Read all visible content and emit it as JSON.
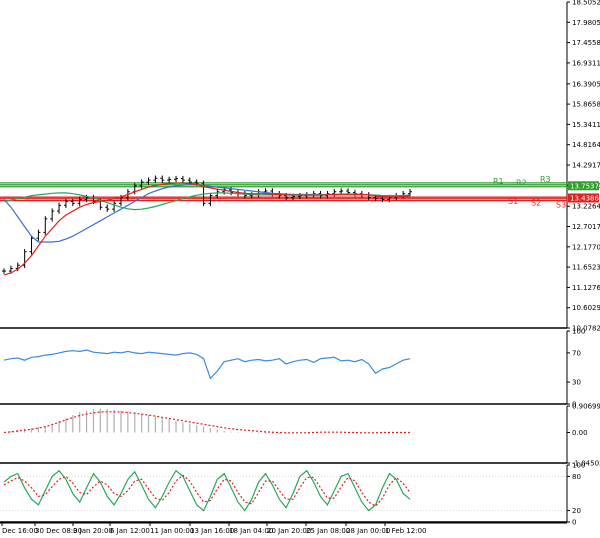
{
  "chart_data": [
    {
      "type": "line",
      "name": "price",
      "y_ticks": [
        "18.50520",
        "17.98050",
        "17.45580",
        "16.93110",
        "16.39050",
        "15.86580",
        "15.34110",
        "14.81640",
        "14.29170",
        "13.76700",
        "13.22640",
        "12.70170",
        "12.17700",
        "11.65230",
        "11.12760",
        "10.60290",
        "10.07820"
      ],
      "price_tags": [
        {
          "label": "13.75374",
          "value": 13.754,
          "color": "#2e9e2e"
        },
        {
          "label": "13.43861",
          "value": 13.439,
          "color": "#e02020"
        }
      ],
      "levels": [
        {
          "name": "R1",
          "value": 13.78,
          "color": "#2e9e2e"
        },
        {
          "name": "R2",
          "value": 13.73,
          "color": "#2e9e2e"
        },
        {
          "name": "R3",
          "value": 13.83,
          "color": "#2e9e2e"
        },
        {
          "name": "S1",
          "value": 13.46,
          "color": "#e02020"
        },
        {
          "name": "S2",
          "value": 13.42,
          "color": "#e02020"
        },
        {
          "name": "S3",
          "value": 13.37,
          "color": "#e02020"
        }
      ],
      "ylim": [
        10.0782,
        18.5052
      ],
      "close": [
        11.55,
        11.62,
        11.7,
        12.05,
        12.4,
        12.55,
        12.9,
        13.1,
        13.25,
        13.35,
        13.3,
        13.4,
        13.45,
        13.35,
        13.2,
        13.15,
        13.3,
        13.45,
        13.6,
        13.75,
        13.85,
        13.9,
        13.95,
        13.9,
        13.92,
        13.94,
        13.9,
        13.85,
        13.82,
        13.3,
        13.5,
        13.6,
        13.65,
        13.58,
        13.55,
        13.5,
        13.52,
        13.6,
        13.62,
        13.55,
        13.5,
        13.45,
        13.48,
        13.5,
        13.52,
        13.55,
        13.5,
        13.55,
        13.6,
        13.62,
        13.58,
        13.55,
        13.52,
        13.45,
        13.42,
        13.4,
        13.45,
        13.5,
        13.55,
        13.6
      ],
      "ma_red": [
        11.45,
        11.5,
        11.6,
        11.75,
        11.95,
        12.2,
        12.45,
        12.65,
        12.85,
        13.0,
        13.1,
        13.2,
        13.27,
        13.32,
        13.35,
        13.38,
        13.42,
        13.47,
        13.53,
        13.6,
        13.66,
        13.72,
        13.76,
        13.79,
        13.81,
        13.82,
        13.82,
        13.81,
        13.79,
        13.73,
        13.7,
        13.67,
        13.64,
        13.61,
        13.58,
        13.56,
        13.55,
        13.55,
        13.55,
        13.54,
        13.53,
        13.52,
        13.51,
        13.51,
        13.51,
        13.51,
        13.51,
        13.52,
        13.53,
        13.54,
        13.54,
        13.54,
        13.53,
        13.52,
        13.5,
        13.48,
        13.47,
        13.47,
        13.48,
        13.5
      ],
      "ma_blue": [
        13.4,
        13.2,
        12.95,
        12.7,
        12.45,
        12.3,
        12.3,
        12.3,
        12.32,
        12.38,
        12.45,
        12.55,
        12.65,
        12.75,
        12.85,
        12.95,
        13.05,
        13.15,
        13.25,
        13.35,
        13.45,
        13.55,
        13.62,
        13.68,
        13.72,
        13.75,
        13.77,
        13.78,
        13.78,
        13.76,
        13.74,
        13.72,
        13.7,
        13.68,
        13.66,
        13.64,
        13.62,
        13.6,
        13.58,
        13.56,
        13.55,
        13.54,
        13.53,
        13.53,
        13.53,
        13.53,
        13.53,
        13.53,
        13.53,
        13.53,
        13.53,
        13.53,
        13.53,
        13.52,
        13.51,
        13.5,
        13.5,
        13.5,
        13.5,
        13.51
      ],
      "ma_green": [
        13.35,
        13.38,
        13.42,
        13.46,
        13.5,
        13.52,
        13.54,
        13.56,
        13.57,
        13.57,
        13.55,
        13.52,
        13.48,
        13.44,
        13.38,
        13.32,
        13.26,
        13.2,
        13.16,
        13.14,
        13.15,
        13.18,
        13.22,
        13.27,
        13.32,
        13.37,
        13.42,
        13.47,
        13.51,
        13.54,
        13.56,
        13.57,
        13.57,
        13.56,
        13.55,
        13.54,
        13.53,
        13.52,
        13.52,
        13.52,
        13.52,
        13.52,
        13.52,
        13.52,
        13.52,
        13.52,
        13.52,
        13.52,
        13.52,
        13.52,
        13.52,
        13.52,
        13.52,
        13.52,
        13.51,
        13.5,
        13.5,
        13.5,
        13.5,
        13.51
      ]
    },
    {
      "type": "line",
      "name": "rsi",
      "y_ticks": [
        "100",
        "70",
        "30",
        "0"
      ],
      "ylim": [
        0,
        100
      ],
      "values": [
        60,
        62,
        63,
        60,
        64,
        65,
        67,
        68,
        70,
        72,
        73,
        72,
        74,
        71,
        70,
        69,
        71,
        70,
        72,
        70,
        69,
        71,
        70,
        69,
        68,
        67,
        69,
        70,
        68,
        62,
        35,
        45,
        58,
        60,
        62,
        58,
        60,
        61,
        59,
        60,
        62,
        55,
        58,
        60,
        61,
        57,
        62,
        63,
        64,
        59,
        60,
        58,
        61,
        55,
        42,
        48,
        50,
        55,
        60,
        62
      ]
    },
    {
      "type": "bar",
      "name": "macd",
      "y_ticks": [
        "0.906998",
        "0.00",
        "-1.045035"
      ],
      "ylim": [
        -1.045035,
        0.906998
      ],
      "values": [
        0.0,
        0.05,
        0.1,
        0.13,
        0.15,
        0.18,
        0.22,
        0.3,
        0.4,
        0.5,
        0.6,
        0.7,
        0.75,
        0.8,
        0.82,
        0.8,
        0.78,
        0.75,
        0.72,
        0.7,
        0.65,
        0.6,
        0.55,
        0.5,
        0.45,
        0.4,
        0.35,
        0.3,
        0.25,
        0.2,
        0.15,
        0.1,
        0.05,
        0.03,
        0.02,
        0.0,
        -0.02,
        -0.03,
        -0.04,
        -0.05,
        -0.05,
        -0.04,
        -0.03,
        -0.02,
        0.0,
        0.02,
        0.03,
        0.02,
        0.01,
        0.0,
        -0.01,
        -0.02,
        -0.02,
        -0.01,
        0.0,
        0.0,
        0.0,
        0.0,
        0.0,
        0.0
      ],
      "signal": [
        0.0,
        0.02,
        0.05,
        0.08,
        0.11,
        0.15,
        0.2,
        0.27,
        0.35,
        0.43,
        0.51,
        0.58,
        0.63,
        0.67,
        0.7,
        0.71,
        0.71,
        0.7,
        0.68,
        0.66,
        0.63,
        0.6,
        0.56,
        0.52,
        0.48,
        0.44,
        0.4,
        0.36,
        0.32,
        0.28,
        0.24,
        0.2,
        0.16,
        0.13,
        0.1,
        0.08,
        0.06,
        0.04,
        0.02,
        0.01,
        0.0,
        -0.01,
        -0.01,
        -0.01,
        -0.01,
        0.0,
        0.01,
        0.01,
        0.01,
        0.01,
        0.0,
        0.0,
        -0.01,
        -0.01,
        -0.01,
        0.0,
        0.0,
        0.0,
        0.0,
        0.0
      ]
    },
    {
      "type": "line",
      "name": "stochastic",
      "y_ticks": [
        "100",
        "80",
        "20",
        "0"
      ],
      "ylim": [
        0,
        100
      ],
      "k": [
        70,
        80,
        85,
        60,
        40,
        30,
        55,
        80,
        90,
        75,
        50,
        35,
        60,
        85,
        70,
        45,
        30,
        50,
        75,
        88,
        65,
        40,
        25,
        45,
        70,
        90,
        80,
        55,
        30,
        20,
        45,
        75,
        85,
        60,
        35,
        20,
        40,
        70,
        85,
        65,
        40,
        25,
        50,
        80,
        90,
        70,
        45,
        30,
        55,
        80,
        85,
        60,
        35,
        20,
        30,
        60,
        85,
        75,
        50,
        40
      ],
      "d": [
        65,
        72,
        78,
        72,
        60,
        45,
        48,
        62,
        75,
        80,
        68,
        52,
        48,
        62,
        72,
        65,
        50,
        45,
        55,
        72,
        75,
        58,
        42,
        38,
        52,
        72,
        82,
        72,
        52,
        35,
        38,
        58,
        75,
        72,
        52,
        35,
        32,
        52,
        72,
        72,
        55,
        40,
        40,
        60,
        78,
        78,
        60,
        42,
        42,
        62,
        78,
        72,
        52,
        35,
        28,
        42,
        65,
        78,
        68,
        52
      ]
    }
  ],
  "x_labels": [
    "Dec 16:00",
    "30 Dec 08:00",
    "3 Jan 20:00",
    "6 Jan 12:00",
    "11 Jan 00:00",
    "13 Jan 16:00",
    "18 Jan 04:00",
    "20 Jan 20:00",
    "25 Jan 08:00",
    "28 Jan 00:00",
    "1 Feb 12:00"
  ]
}
